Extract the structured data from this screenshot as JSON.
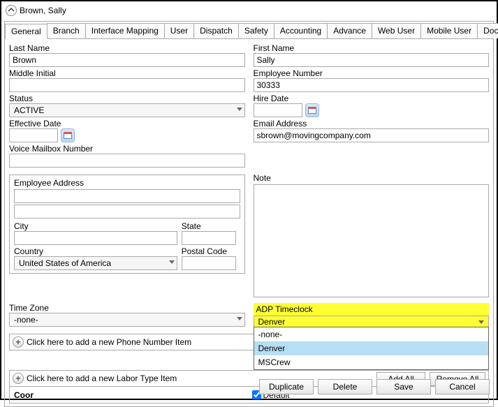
{
  "header": {
    "title": "Brown, Sally"
  },
  "tabs": [
    "General",
    "Branch",
    "Interface Mapping",
    "User",
    "Dispatch",
    "Safety",
    "Accounting",
    "Advance",
    "Web User",
    "Mobile User",
    "Documents"
  ],
  "labels": {
    "lastName": "Last Name",
    "firstName": "First Name",
    "middleInitial": "Middle Initial",
    "employeeNumber": "Employee Number",
    "status": "Status",
    "hireDate": "Hire Date",
    "effectiveDate": "Effective Date",
    "emailAddress": "Email Address",
    "voiceMailbox": "Voice Mailbox Number",
    "employeeAddress": "Employee Address",
    "city": "City",
    "state": "State",
    "country": "Country",
    "postalCode": "Postal Code",
    "note": "Note",
    "timeZone": "Time Zone",
    "adpTimeclock": "ADP Timeclock",
    "addPhone": "Click here to add a new Phone Number Item",
    "addLabor": "Click here to add a new Labor Type Item",
    "coor": "Coor",
    "default": "Default"
  },
  "values": {
    "lastName": "Brown",
    "firstName": "Sally",
    "middleInitial": "",
    "employeeNumber": "30333",
    "status": "ACTIVE",
    "hireDate": "",
    "effectiveDate": "",
    "email": "sbrown@movingcompany.com",
    "voiceMailbox": "",
    "addr1": "",
    "addr2": "",
    "city": "",
    "state": "",
    "country": "United States of America",
    "postalCode": "",
    "note": "",
    "timeZone": "-none-",
    "adpTimeclock": "Denver",
    "defaultChecked": true
  },
  "adpOptions": [
    "-none-",
    "Denver",
    "MSCrew"
  ],
  "buttons": {
    "addAll": "Add All",
    "removeAll": "Remove All",
    "duplicate": "Duplicate",
    "delete": "Delete",
    "save": "Save",
    "cancel": "Cancel"
  }
}
